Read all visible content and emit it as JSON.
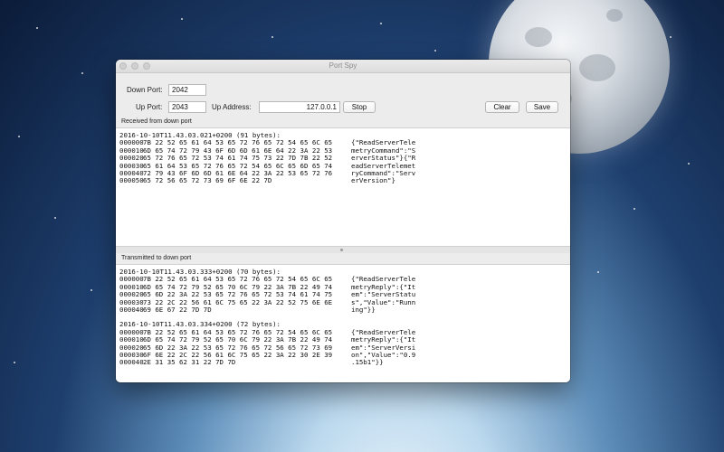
{
  "window": {
    "title": "Port Spy"
  },
  "form": {
    "down_port_label": "Down Port:",
    "down_port_value": "2042",
    "up_port_label": "Up Port:",
    "up_port_value": "2043",
    "up_address_label": "Up Address:",
    "up_address_value": "127.0.0.1",
    "stop_label": "Stop",
    "clear_label": "Clear",
    "save_label": "Save"
  },
  "received": {
    "label": "Received from down port",
    "entries": [
      {
        "header": "2016-10-10T11.43.03.021+0200 (91 bytes):",
        "rows": [
          {
            "offset": "000000",
            "hex": "7B 22 52 65 61 64 53 65 72 76 65 72 54 65 6C 65",
            "ascii": "{\"ReadServerTele"
          },
          {
            "offset": "000010",
            "hex": "6D 65 74 72 79 43 6F 6D 6D 61 6E 64 22 3A 22 53",
            "ascii": "metryCommand\":\"S"
          },
          {
            "offset": "000020",
            "hex": "65 72 76 65 72 53 74 61 74 75 73 22 7D 7B 22 52",
            "ascii": "erverStatus\"}{\"R"
          },
          {
            "offset": "000030",
            "hex": "65 61 64 53 65 72 76 65 72 54 65 6C 65 6D 65 74",
            "ascii": "eadServerTelemet"
          },
          {
            "offset": "000040",
            "hex": "72 79 43 6F 6D 6D 61 6E 64 22 3A 22 53 65 72 76",
            "ascii": "ryCommand\":\"Serv"
          },
          {
            "offset": "000050",
            "hex": "65 72 56 65 72 73 69 6F 6E 22 7D",
            "ascii": "erVersion\"}"
          }
        ]
      }
    ]
  },
  "transmitted": {
    "label": "Transmitted to down port",
    "entries": [
      {
        "header": "2016-10-10T11.43.03.333+0200 (70 bytes):",
        "rows": [
          {
            "offset": "000000",
            "hex": "7B 22 52 65 61 64 53 65 72 76 65 72 54 65 6C 65",
            "ascii": "{\"ReadServerTele"
          },
          {
            "offset": "000010",
            "hex": "6D 65 74 72 79 52 65 70 6C 79 22 3A 7B 22 49 74",
            "ascii": "metryReply\":{\"It"
          },
          {
            "offset": "000020",
            "hex": "65 6D 22 3A 22 53 65 72 76 65 72 53 74 61 74 75",
            "ascii": "em\":\"ServerStatu"
          },
          {
            "offset": "000030",
            "hex": "73 22 2C 22 56 61 6C 75 65 22 3A 22 52 75 6E 6E",
            "ascii": "s\",\"Value\":\"Runn"
          },
          {
            "offset": "000040",
            "hex": "69 6E 67 22 7D 7D",
            "ascii": "ing\"}}"
          }
        ]
      },
      {
        "header": "2016-10-10T11.43.03.334+0200 (72 bytes):",
        "rows": [
          {
            "offset": "000000",
            "hex": "7B 22 52 65 61 64 53 65 72 76 65 72 54 65 6C 65",
            "ascii": "{\"ReadServerTele"
          },
          {
            "offset": "000010",
            "hex": "6D 65 74 72 79 52 65 70 6C 79 22 3A 7B 22 49 74",
            "ascii": "metryReply\":{\"It"
          },
          {
            "offset": "000020",
            "hex": "65 6D 22 3A 22 53 65 72 76 65 72 56 65 72 73 69",
            "ascii": "em\":\"ServerVersi"
          },
          {
            "offset": "000030",
            "hex": "6F 6E 22 2C 22 56 61 6C 75 65 22 3A 22 30 2E 39",
            "ascii": "on\",\"Value\":\"0.9"
          },
          {
            "offset": "000040",
            "hex": "2E 31 35 62 31 22 7D 7D",
            "ascii": ".15b1\"}}"
          }
        ]
      }
    ]
  }
}
